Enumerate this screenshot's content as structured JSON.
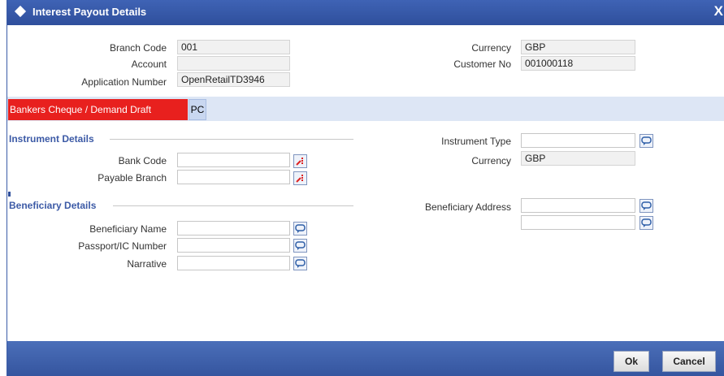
{
  "window": {
    "title": "Interest Payout Details",
    "close_label": "X"
  },
  "header": {
    "branch_code": {
      "label": "Branch Code",
      "value": "001"
    },
    "account": {
      "label": "Account",
      "value": ""
    },
    "application_number": {
      "label": "Application Number",
      "value": "OpenRetailTD3946"
    },
    "currency": {
      "label": "Currency",
      "value": "GBP"
    },
    "customer_no": {
      "label": "Customer No",
      "value": "001000118"
    }
  },
  "tabs": [
    {
      "label": "Bankers Cheque / Demand Draft",
      "active": true
    },
    {
      "label": "PC",
      "active": false
    }
  ],
  "instrument": {
    "section_title": "Instrument Details",
    "bank_code": {
      "label": "Bank Code",
      "value": ""
    },
    "payable_branch": {
      "label": "Payable Branch",
      "value": ""
    },
    "instrument_type": {
      "label": "Instrument Type",
      "value": ""
    },
    "currency": {
      "label": "Currency",
      "value": "GBP"
    }
  },
  "beneficiary": {
    "section_title": "Beneficiary Details",
    "name": {
      "label": "Beneficiary Name",
      "value": ""
    },
    "passport": {
      "label": "Passport/IC Number",
      "value": ""
    },
    "narrative": {
      "label": "Narrative",
      "value": ""
    },
    "address": {
      "label": "Beneficiary Address",
      "line1": "",
      "line2": ""
    }
  },
  "footer": {
    "ok_label": "Ok",
    "cancel_label": "Cancel"
  },
  "colors": {
    "titlebar": "#2f4f9c",
    "active_tab": "#e8201e",
    "section": "#3c5aa6"
  }
}
